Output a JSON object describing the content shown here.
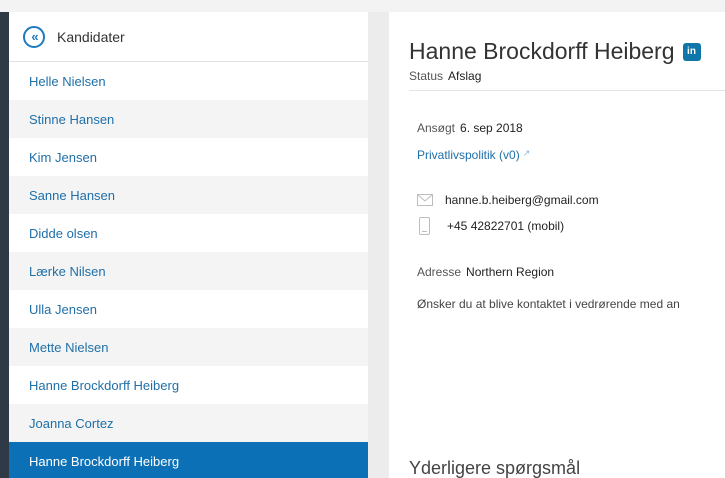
{
  "sidebar": {
    "title": "Kandidater",
    "items": [
      {
        "label": "Helle Nielsen"
      },
      {
        "label": "Stinne Hansen"
      },
      {
        "label": "Kim Jensen"
      },
      {
        "label": "Sanne Hansen"
      },
      {
        "label": "Didde olsen"
      },
      {
        "label": "Lærke Nilsen"
      },
      {
        "label": "Ulla Jensen"
      },
      {
        "label": "Mette Nielsen"
      },
      {
        "label": "Hanne Brockdorff Heiberg"
      },
      {
        "label": "Joanna Cortez"
      },
      {
        "label": "Hanne Brockdorff Heiberg",
        "selected": true
      }
    ]
  },
  "candidate": {
    "name": "Hanne Brockdorff Heiberg",
    "linkedin_badge": "in",
    "status_label": "Status",
    "status_value": "Afslag",
    "applied_label": "Ansøgt",
    "applied_value": "6. sep 2018",
    "privacy_link": "Privatlivspolitik (v0)",
    "email": "hanne.b.heiberg@gmail.com",
    "phone": "+45 42822701 (mobil)",
    "address_label": "Adresse",
    "address_value": "Northern Region",
    "consent_text": "Ønsker du at blive kontaktet i vedrørende med an"
  },
  "sections": {
    "additional_questions": "Yderligere spørgsmål"
  },
  "colors": {
    "accent": "#0b70b5",
    "link": "#1f6fa8",
    "dark_bar": "#2f3a46",
    "linkedin": "#0e76a8"
  },
  "icons": [
    "back-chevrons-icon",
    "linkedin-icon",
    "external-link-icon",
    "mail-icon",
    "mobile-phone-icon"
  ]
}
